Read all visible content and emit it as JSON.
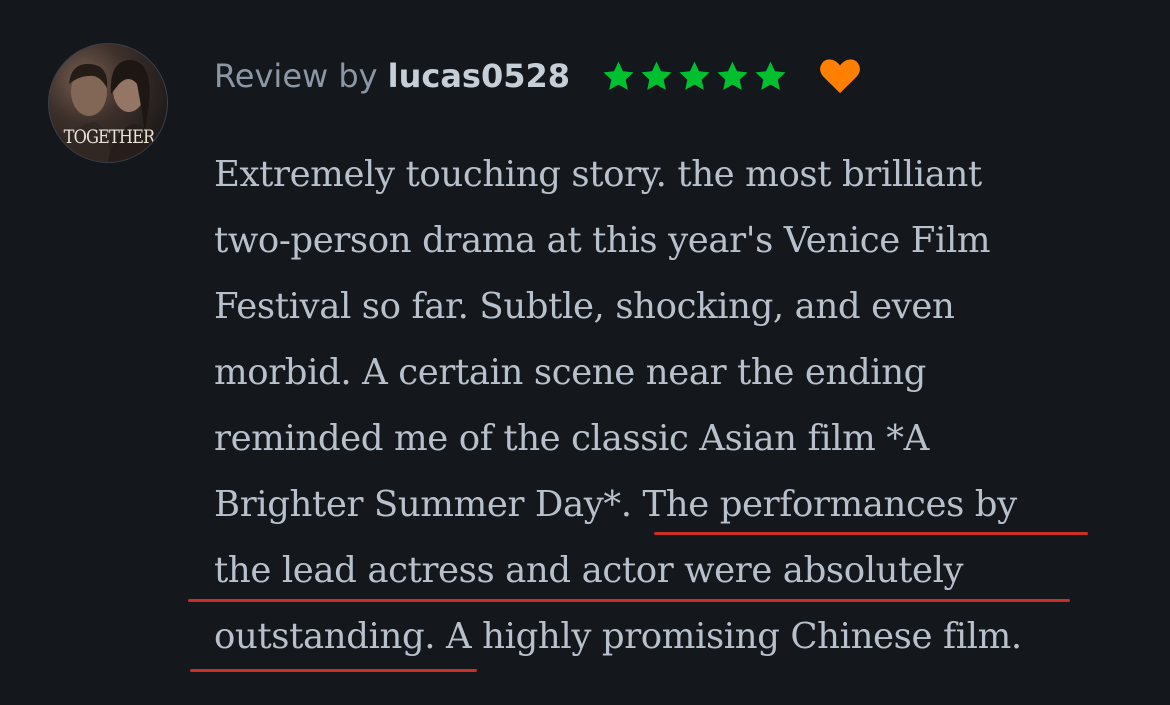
{
  "review": {
    "prefix": "Review by",
    "username": "lucas0528",
    "rating_stars": 5,
    "liked": true,
    "avatar_text": "TOGETHER",
    "body_lines": [
      "Extremely touching story. the most brilliant",
      "two-person drama at this year's Venice Film",
      "Festival so far. Subtle, shocking, and even",
      "morbid. A certain scene near the ending",
      "reminded me of the classic Asian film *A",
      "Brighter Summer Day*. The performances by",
      "the lead actress and actor were absolutely",
      "outstanding. A highly promising Chinese film."
    ]
  },
  "colors": {
    "background": "#14181c",
    "star": "#00c030",
    "heart": "#ff8000",
    "underline": "#c92e27",
    "text": "#b7c0cb"
  },
  "icons": {
    "stars": "star-icon",
    "heart": "heart-icon"
  }
}
